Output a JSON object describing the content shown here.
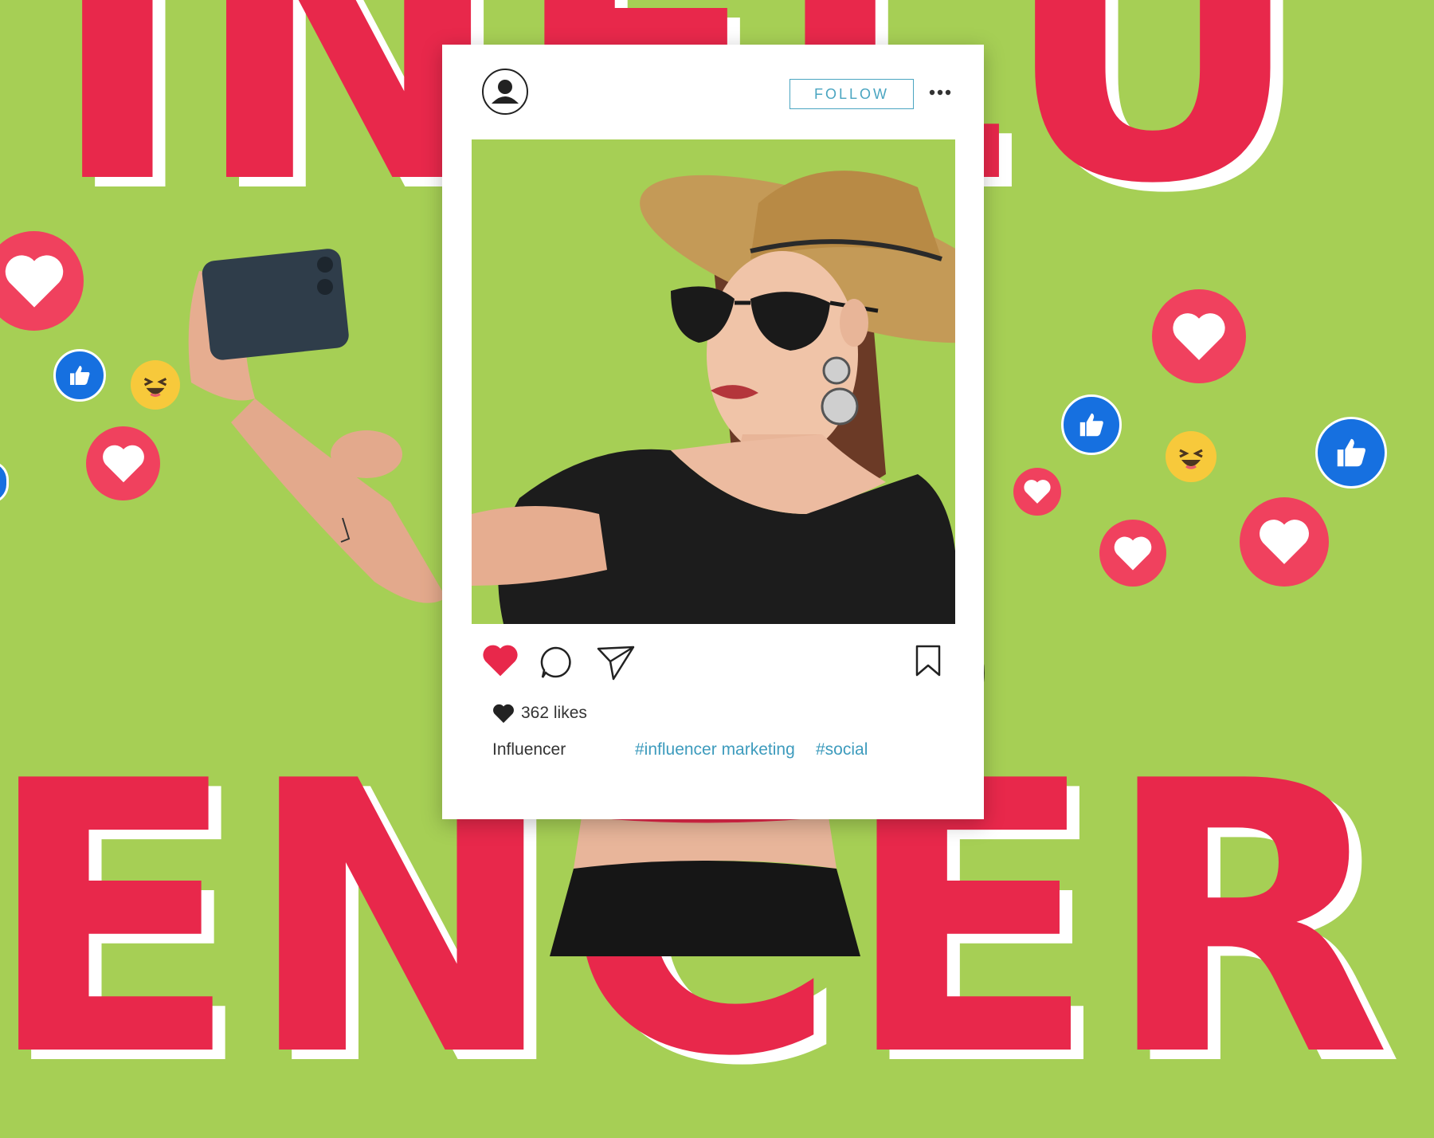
{
  "background": {
    "word_top": "INFLU",
    "word_bottom": "ENCER",
    "bg_color": "#a6cf55",
    "letter_color": "#e8284b"
  },
  "post": {
    "follow_label": "FOLLOW",
    "more_icon": "more-horizontal-icon",
    "avatar_icon": "user-avatar-icon",
    "likes_text": "362 likes",
    "username": "Influencer",
    "hashtags": [
      "#influencer marketing",
      "#social"
    ],
    "action_icons": [
      "heart-icon",
      "comment-icon",
      "share-icon",
      "bookmark-icon"
    ]
  },
  "reactions": [
    "heart",
    "like",
    "laugh"
  ],
  "colors": {
    "heart": "#f0415e",
    "like": "#1670e0",
    "laugh": "#f7c93b",
    "accent": "#4aa5c1"
  }
}
